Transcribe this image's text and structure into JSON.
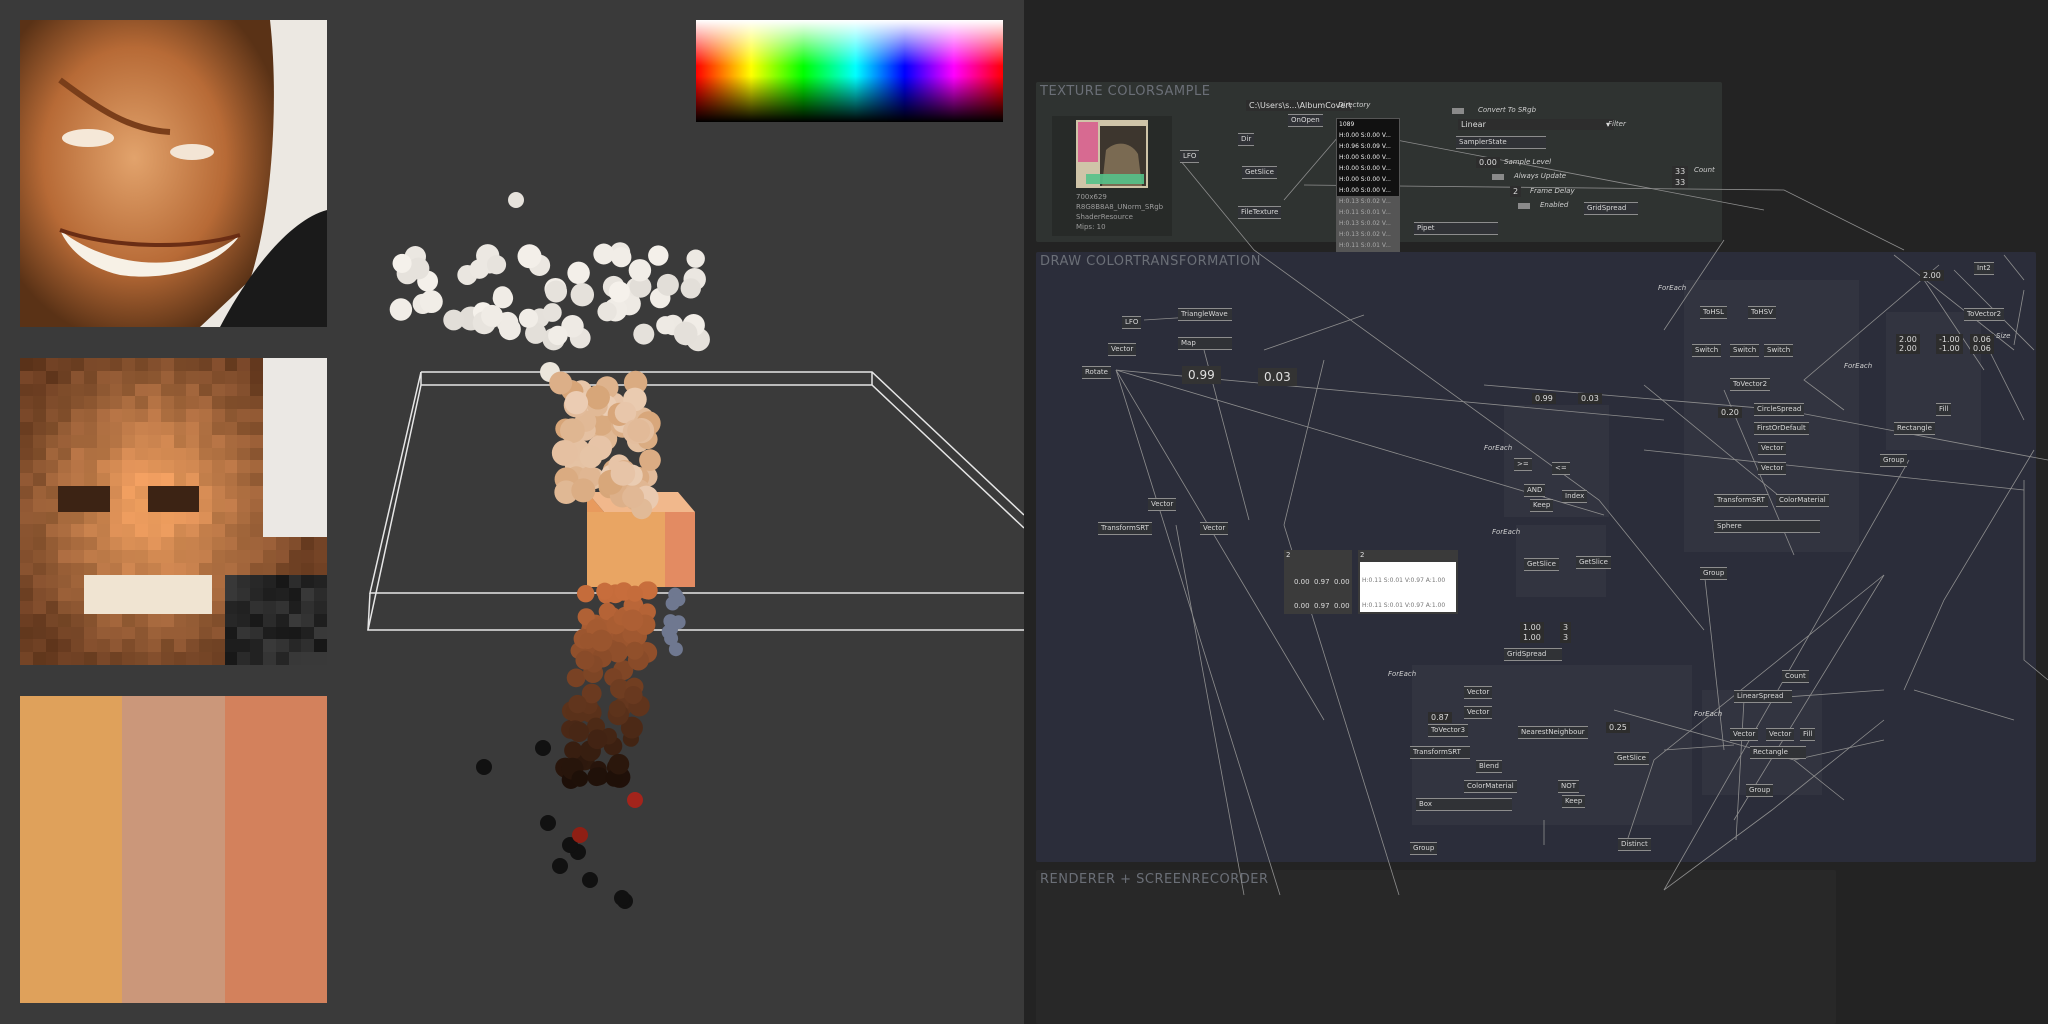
{
  "viewport": {
    "swatch_colors": [
      "#dfa15b",
      "#cb977a",
      "#d3815c"
    ],
    "spectrum": "hue-lightness spectrum"
  },
  "patch": {
    "groups": {
      "texture": "TEXTURE COLORSAMPLE",
      "draw": "DRAW COLORTRANSFORMATION",
      "render": "RENDERER + SCREENRECORDER"
    },
    "texture": {
      "info": [
        "700x629",
        "R8G8B8A8_UNorm_SRgb",
        "ShaderResource",
        "Mips: 10"
      ],
      "path": "C:\\Users\\s...\\AlbumCover\\",
      "directory_label": "Directory",
      "onopen": "OnOpen",
      "dir": "Dir",
      "getslice": "GetSlice",
      "filetexture": "FileTexture",
      "lfo": "LFO",
      "count_value": "1089",
      "spread_rows": [
        "H:0.00 S:0.00 V...",
        "H:0.96 S:0.09 V...",
        "H:0.00 S:0.00 V...",
        "H:0.00 S:0.00 V...",
        "H:0.00 S:0.00 V...",
        "H:0.00 S:0.00 V..."
      ],
      "spread_rows_dim": [
        "H:0.13 S:0.02 V...",
        "H:0.11 S:0.01 V...",
        "H:0.13 S:0.02 V...",
        "H:0.13 S:0.02 V...",
        "H:0.11 S:0.01 V..."
      ],
      "convert_srgb": "Convert To SRgb",
      "linear": "Linear",
      "filter": "Filter",
      "samplerstate": "SamplerState",
      "sample_level_val": "0.00",
      "sample_level": "Sample Level",
      "always_update": "Always Update",
      "frame_delay_val": "2",
      "frame_delay": "Frame Delay",
      "enabled": "Enabled",
      "pipet": "Pipet",
      "gridspread": "GridSpread",
      "count_a": "33",
      "count_b": "33",
      "count_label": "Count"
    },
    "draw": {
      "foreach": "ForEach",
      "lfo": "LFO",
      "vector": "Vector",
      "rotate": "Rotate",
      "trianglewave": "TriangleWave",
      "map": "Map",
      "val_099": "0.99",
      "val_003": "0.03",
      "transformsrt": "TransformSRT",
      "tohsl": "ToHSL",
      "tohsv": "ToHSV",
      "switch": "Switch",
      "tovector2": "ToVector2",
      "circlespread": "CircleSpread",
      "firstordefault": "FirstOrDefault",
      "val_020": "0.20",
      "colormaterial": "ColorMaterial",
      "sphere": "Sphere",
      "group": "Group",
      "int2": "Int2",
      "val_200": "2.00",
      "size_vals": [
        "2.00",
        "2.00",
        "-1.00",
        "-1.00",
        "0.06",
        "0.06"
      ],
      "size": "Size",
      "fill": "Fill",
      "rectangle": "Rectangle",
      "and": "AND",
      "keep": "Keep",
      "index": "Index",
      "ge": ">=",
      "le": "<=",
      "getslice": "GetSlice",
      "spread_count": "2",
      "table_vals": [
        "0.00",
        "0.97",
        "0.00",
        "0.00",
        "0.97",
        "0.00"
      ],
      "white_rows": [
        "H:0.11 S:0.01 V:0.97 A:1.00",
        "H:0.11 S:0.01 V:0.97 A:1.00"
      ],
      "one_vals": [
        "1.00",
        "1.00"
      ],
      "three_vals": [
        "3",
        "3"
      ],
      "gridspread": "GridSpread",
      "tovector3": "ToVector3",
      "val_087": "0.87",
      "val_025": "0.25",
      "nearestneighbour": "NearestNeighbour",
      "blend": "Blend",
      "not": "NOT",
      "box": "Box",
      "distinct": "Distinct",
      "linearspread": "LinearSpread",
      "count": "Count"
    }
  }
}
